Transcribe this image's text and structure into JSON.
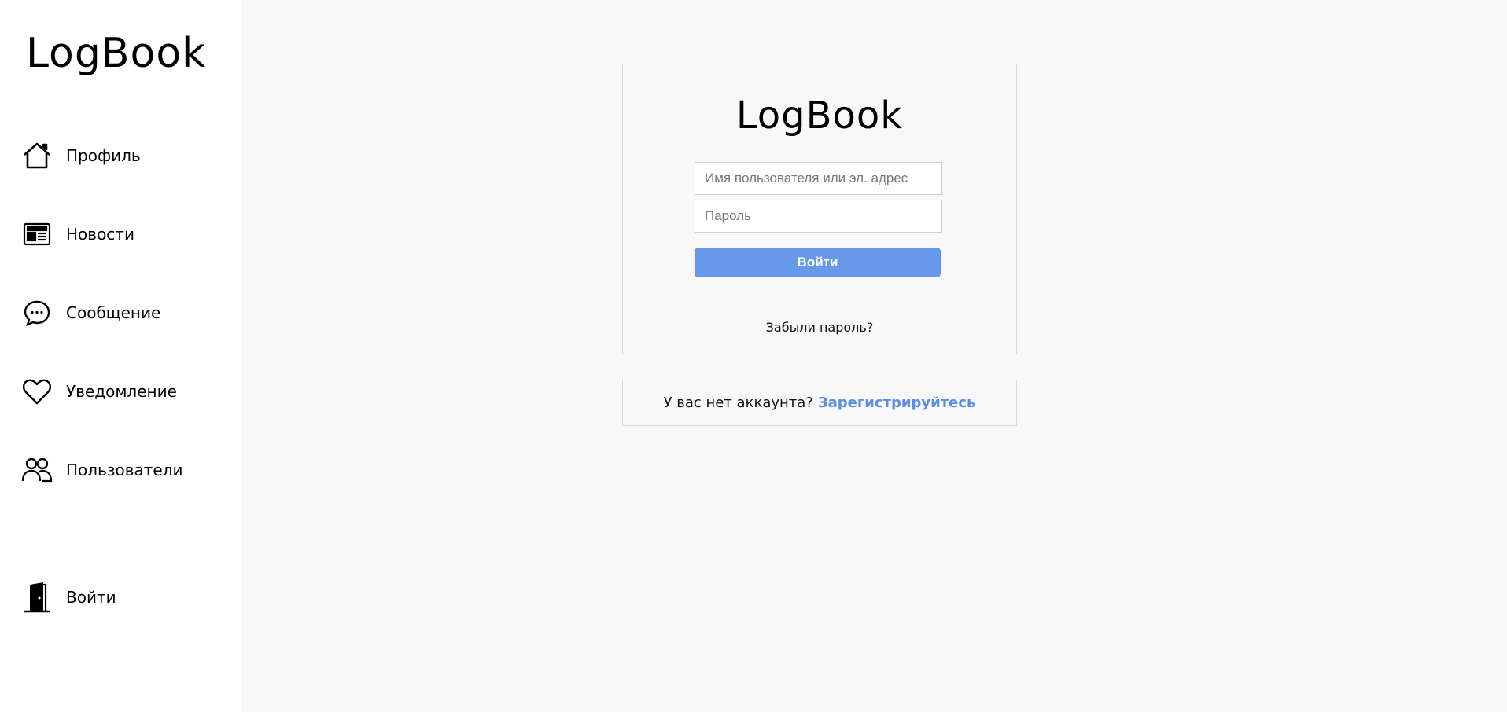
{
  "app": {
    "brand": "LogBook"
  },
  "sidebar": {
    "items": [
      {
        "label": "Профиль",
        "icon": "home-icon"
      },
      {
        "label": "Новости",
        "icon": "newspaper-icon"
      },
      {
        "label": "Сообщение",
        "icon": "chat-bubble-icon"
      },
      {
        "label": "Уведомление",
        "icon": "heart-icon"
      },
      {
        "label": "Пользователи",
        "icon": "users-icon"
      }
    ],
    "login": {
      "label": "Войти",
      "icon": "door-icon"
    }
  },
  "login_form": {
    "logo": "LogBook",
    "username_placeholder": "Имя пользователя или эл. адрес",
    "username_value": "",
    "password_placeholder": "Пароль",
    "password_value": "",
    "submit_label": "Войти",
    "forgot_label": "Забыли пароль?"
  },
  "signup": {
    "prompt": "У вас нет аккаунта?",
    "link_label": "Зарегистрируйтесь"
  },
  "colors": {
    "accent": "#6699e9",
    "link": "#5b8fe3",
    "background": "#f8f8f8",
    "sidebar_background": "#ffffff"
  }
}
